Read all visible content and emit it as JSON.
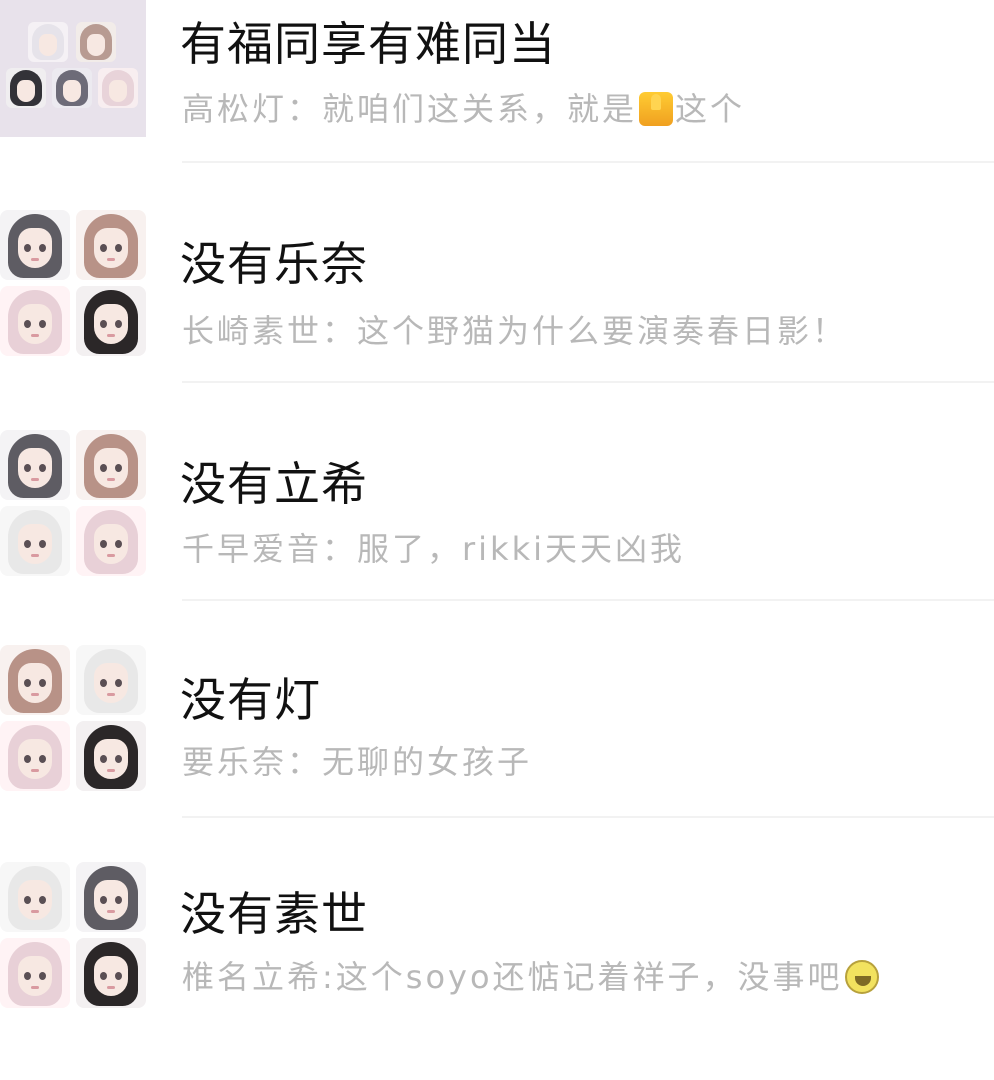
{
  "chats": [
    {
      "name": "有福同享有难同当",
      "preview_before_emoji": "高松灯：就咱们这关系，就是",
      "preview_emoji": "thumbs-up",
      "preview_after_emoji": "这个"
    },
    {
      "name": "没有乐奈",
      "preview": "长崎素世：这个野猫为什么要演奏春日影！"
    },
    {
      "name": "没有立希",
      "preview": "千早爱音：服了，rikki天天凶我"
    },
    {
      "name": "没有灯",
      "preview": "要乐奈：无聊的女孩子"
    },
    {
      "name": "没有素世",
      "preview_before_emoji": "椎名立希:这个soyo还惦记着祥子，没事吧",
      "preview_emoji": "laughing-face"
    }
  ],
  "icons": {
    "thumbs_up": "thumbs-up-emoji",
    "laughing": "laughing-emoji"
  }
}
